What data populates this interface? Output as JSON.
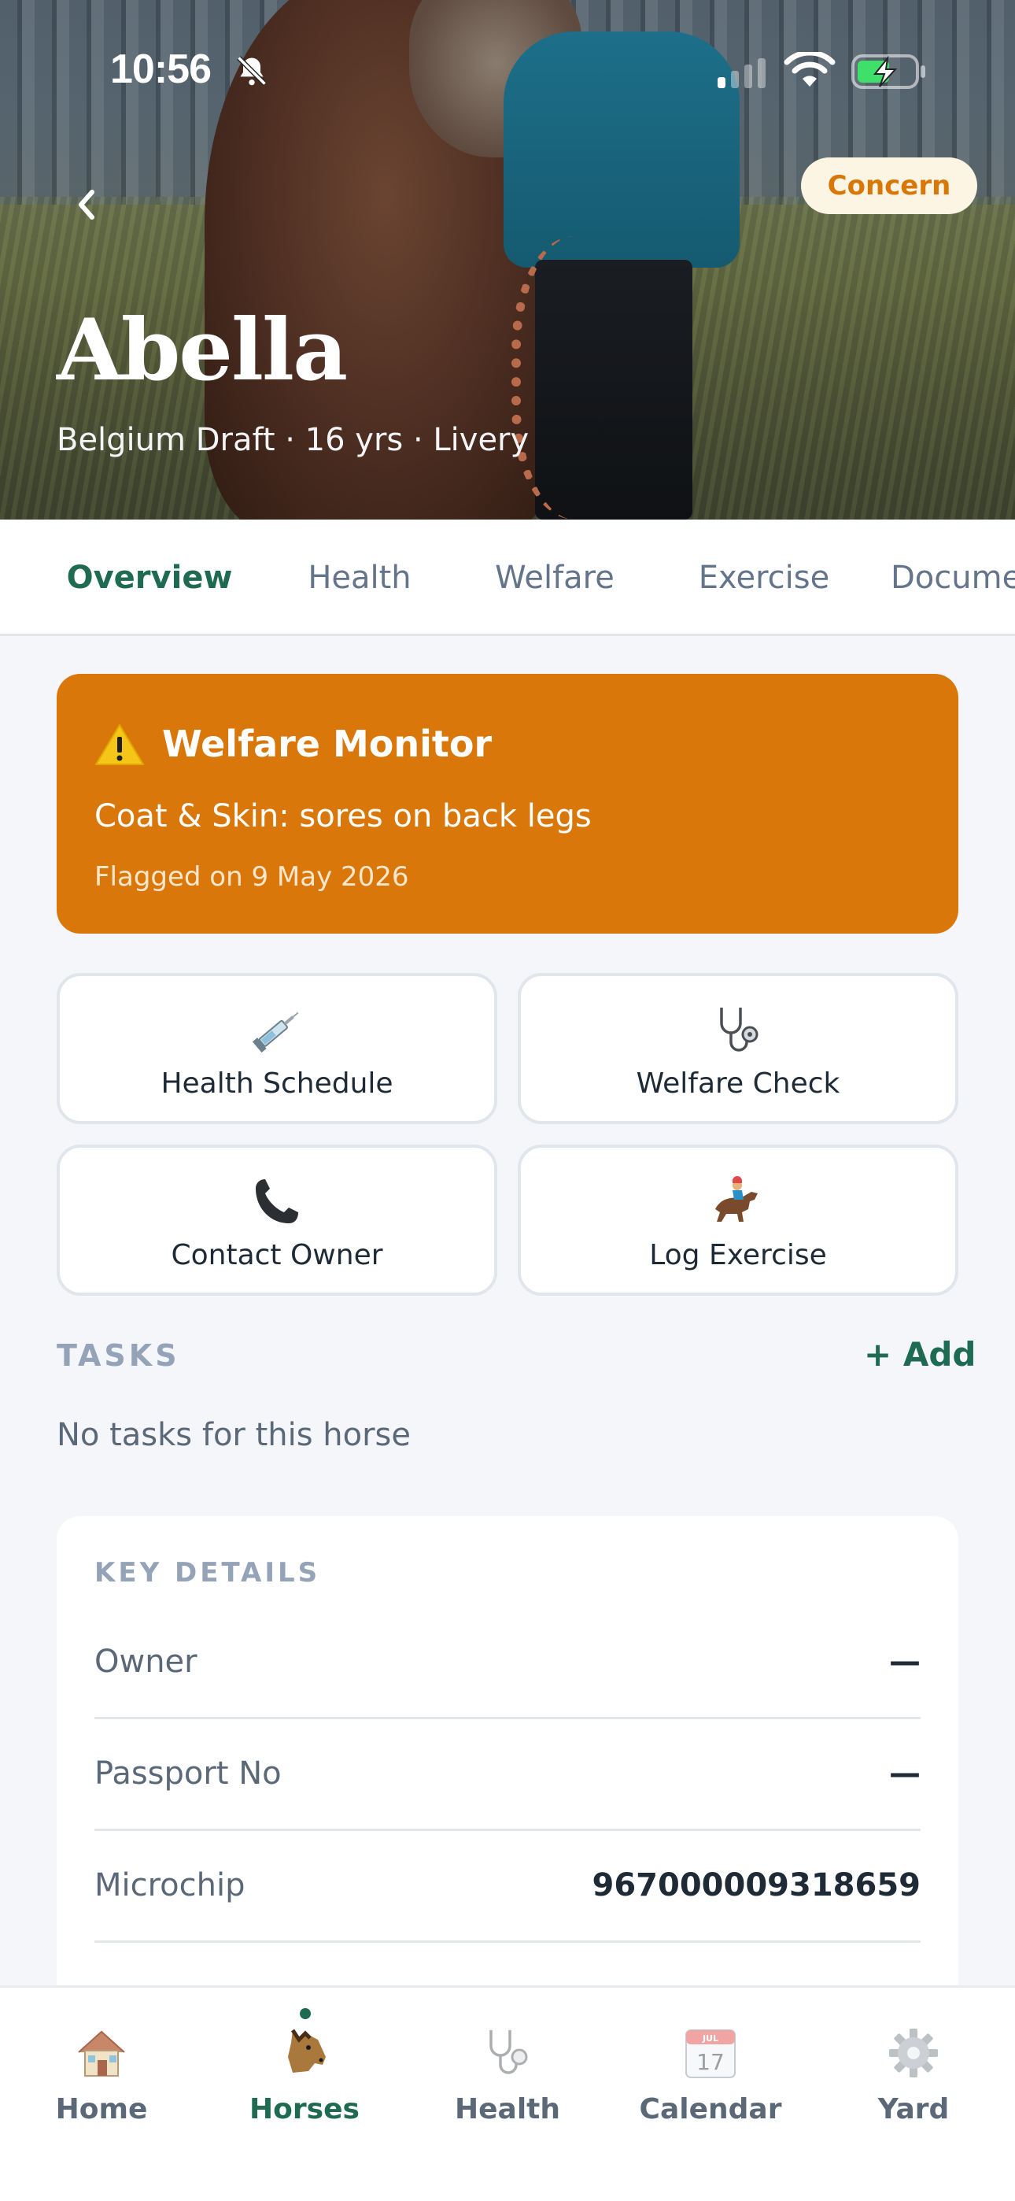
{
  "status_bar": {
    "time": "10:56",
    "icons": [
      "bell-off-icon",
      "signal-icon",
      "wifi-icon",
      "battery-charging-icon"
    ]
  },
  "hero": {
    "name": "Abella",
    "meta": "Belgium Draft · 16 yrs · Livery",
    "badge": "Concern",
    "back_icon": "chevron-left-icon"
  },
  "tabs": [
    "Overview",
    "Health",
    "Welfare",
    "Exercise",
    "Documents"
  ],
  "active_tab": "Overview",
  "welfare_alert": {
    "icon": "warning-icon",
    "title": "Welfare Monitor",
    "text": "Coat & Skin: sores on back legs",
    "date": "Flagged on 9 May 2026"
  },
  "actions": [
    {
      "label": "Health Schedule",
      "icon": "syringe-icon"
    },
    {
      "label": "Welfare Check",
      "icon": "stethoscope-icon"
    },
    {
      "label": "Contact Owner",
      "icon": "phone-icon"
    },
    {
      "label": "Log Exercise",
      "icon": "horse-racing-icon"
    }
  ],
  "tasks": {
    "heading": "TASKS",
    "add_label": "+ Add",
    "empty_text": "No tasks for this horse"
  },
  "key_details": {
    "heading": "KEY DETAILS",
    "rows": [
      {
        "label": "Owner",
        "value": "—"
      },
      {
        "label": "Passport No",
        "value": "—"
      },
      {
        "label": "Microchip",
        "value": "967000009318659"
      }
    ]
  },
  "bottom_nav": {
    "items": [
      {
        "label": "Home",
        "icon": "house-icon"
      },
      {
        "label": "Horses",
        "icon": "horse-face-icon"
      },
      {
        "label": "Health",
        "icon": "stethoscope-icon"
      },
      {
        "label": "Calendar",
        "icon": "calendar-icon",
        "month": "JUL",
        "day": "17"
      },
      {
        "label": "Yard",
        "icon": "gear-icon"
      }
    ],
    "active": "Horses"
  },
  "colors": {
    "accent": "#1e6b52",
    "warning": "#d9770a",
    "concern_text": "#d97706"
  }
}
